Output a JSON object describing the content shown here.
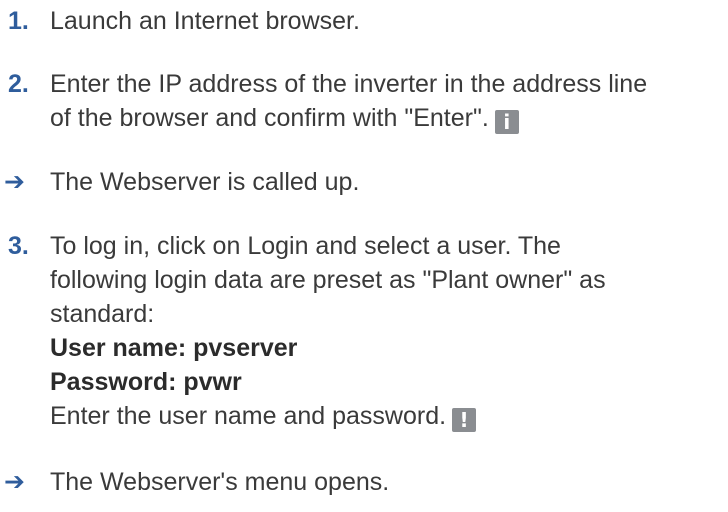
{
  "colors": {
    "marker": "#2f5d9c",
    "text": "#3a3a3a",
    "badge": "#8a8d91"
  },
  "steps": [
    {
      "marker": "1.",
      "lines": [
        "Launch an Internet browser."
      ]
    },
    {
      "marker": "2.",
      "lines": [
        "Enter the IP address of the inverter in the address line",
        "of the browser and confirm with \"Enter\"."
      ],
      "badge": {
        "icon": "info-icon",
        "glyph": "i"
      }
    },
    {
      "result_marker": "➔",
      "lines": [
        "The Webserver is called up."
      ]
    },
    {
      "marker": "3.",
      "lines": [
        "To log in, click on Login and select a user. The",
        "following login data are preset as \"Plant owner\" as",
        "standard:"
      ],
      "username": "User name: pvserver",
      "password": "Password: pvwr",
      "instruction": "Enter the user name and password.",
      "badge": {
        "icon": "warning-icon",
        "glyph": "!"
      }
    },
    {
      "result_marker": "➔",
      "lines": [
        "The Webserver's menu opens."
      ]
    }
  ]
}
